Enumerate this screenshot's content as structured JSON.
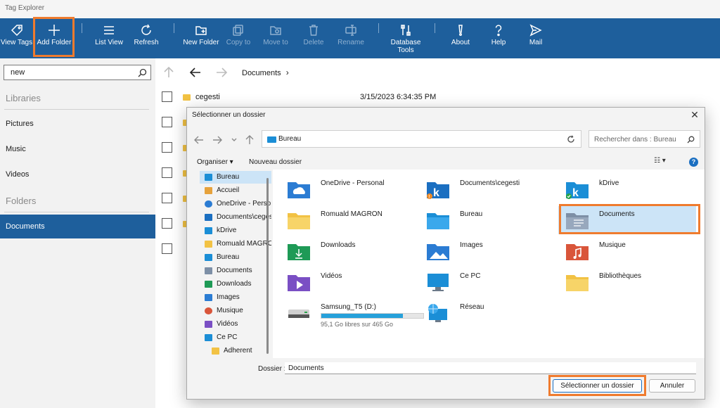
{
  "app": {
    "title": "Tag Explorer"
  },
  "toolbar": {
    "items": [
      {
        "label": "View Tags",
        "icon": "tag-icon"
      },
      {
        "label": "Add Folder",
        "icon": "plus-icon"
      },
      {
        "label": "List View",
        "icon": "list-icon"
      },
      {
        "label": "Refresh",
        "icon": "refresh-icon"
      },
      {
        "label": "New Folder",
        "icon": "new-folder-icon"
      },
      {
        "label": "Copy to",
        "icon": "copy-icon"
      },
      {
        "label": "Move to",
        "icon": "move-icon"
      },
      {
        "label": "Delete",
        "icon": "trash-icon"
      },
      {
        "label": "Rename",
        "icon": "rename-icon"
      },
      {
        "label": "Database\nTools",
        "icon": "tools-icon"
      },
      {
        "label": "About",
        "icon": "exclamation-icon"
      },
      {
        "label": "Help",
        "icon": "question-icon"
      },
      {
        "label": "Mail",
        "icon": "send-icon"
      }
    ],
    "highlight_color": "#ef7b2e",
    "background": "#1e5f9c"
  },
  "sidebar": {
    "search_value": "new",
    "libraries_header": "Libraries",
    "libraries": [
      "Pictures",
      "Music",
      "Videos"
    ],
    "folders_header": "Folders",
    "folders": [
      "Documents"
    ]
  },
  "main": {
    "breadcrumb": "Documents",
    "files": [
      {
        "name": "cegesti",
        "date": "3/15/2023 6:34:35 PM"
      }
    ]
  },
  "dialog": {
    "title": "Sélectionner un dossier",
    "address": "Bureau",
    "search_placeholder": "Rechercher dans : Bureau",
    "organize_label": "Organiser ▾",
    "new_folder_label": "Nouveau dossier",
    "tree": [
      {
        "label": "Bureau",
        "color": "#1b8ed6"
      },
      {
        "label": "Accueil",
        "color": "#e6a23c"
      },
      {
        "label": "OneDrive - Perso",
        "color": "#2b7cd3"
      },
      {
        "label": "Documents\\cegesti",
        "color": "#1b6fc1"
      },
      {
        "label": "kDrive",
        "color": "#1b8ed6"
      },
      {
        "label": "Romuald MAGRON",
        "color": "#f2c244"
      },
      {
        "label": "Bureau",
        "color": "#1b8ed6"
      },
      {
        "label": "Documents",
        "color": "#7d8fa6"
      },
      {
        "label": "Downloads",
        "color": "#1e9a56"
      },
      {
        "label": "Images",
        "color": "#2b7cd3"
      },
      {
        "label": "Musique",
        "color": "#d9553a"
      },
      {
        "label": "Vidéos",
        "color": "#7a4fc4"
      },
      {
        "label": "Ce PC",
        "color": "#1b8ed6"
      },
      {
        "label": "Adherent",
        "color": "#f2c244"
      }
    ],
    "items": [
      {
        "label": "OneDrive - Personal",
        "color": "#2b7cd3"
      },
      {
        "label": "Documents\\cegesti",
        "color": "#1b6fc1"
      },
      {
        "label": "kDrive",
        "color": "#1b8ed6"
      },
      {
        "label": "Romuald MAGRON",
        "color": "#f2c244"
      },
      {
        "label": "Bureau",
        "color": "#1b8ed6"
      },
      {
        "label": "Documents",
        "color": "#7d8fa6"
      },
      {
        "label": "Downloads",
        "color": "#1e9a56"
      },
      {
        "label": "Images",
        "color": "#2b7cd3"
      },
      {
        "label": "Musique",
        "color": "#d9553a"
      },
      {
        "label": "Vidéos",
        "color": "#7a4fc4"
      },
      {
        "label": "Ce PC",
        "color": "#1b8ed6"
      },
      {
        "label": "Bibliothèques",
        "color": "#f2c244"
      },
      {
        "label": "Samsung_T5 (D:)",
        "color": "#555555"
      },
      {
        "label": "Réseau",
        "color": "#1b8ed6"
      }
    ],
    "drive_info": "95,1 Go libres sur 465 Go",
    "drive_used_fraction": 0.8,
    "folder_label": "Dossier :",
    "folder_value": "Documents",
    "select_button": "Sélectionner un dossier",
    "cancel_button": "Annuler"
  }
}
